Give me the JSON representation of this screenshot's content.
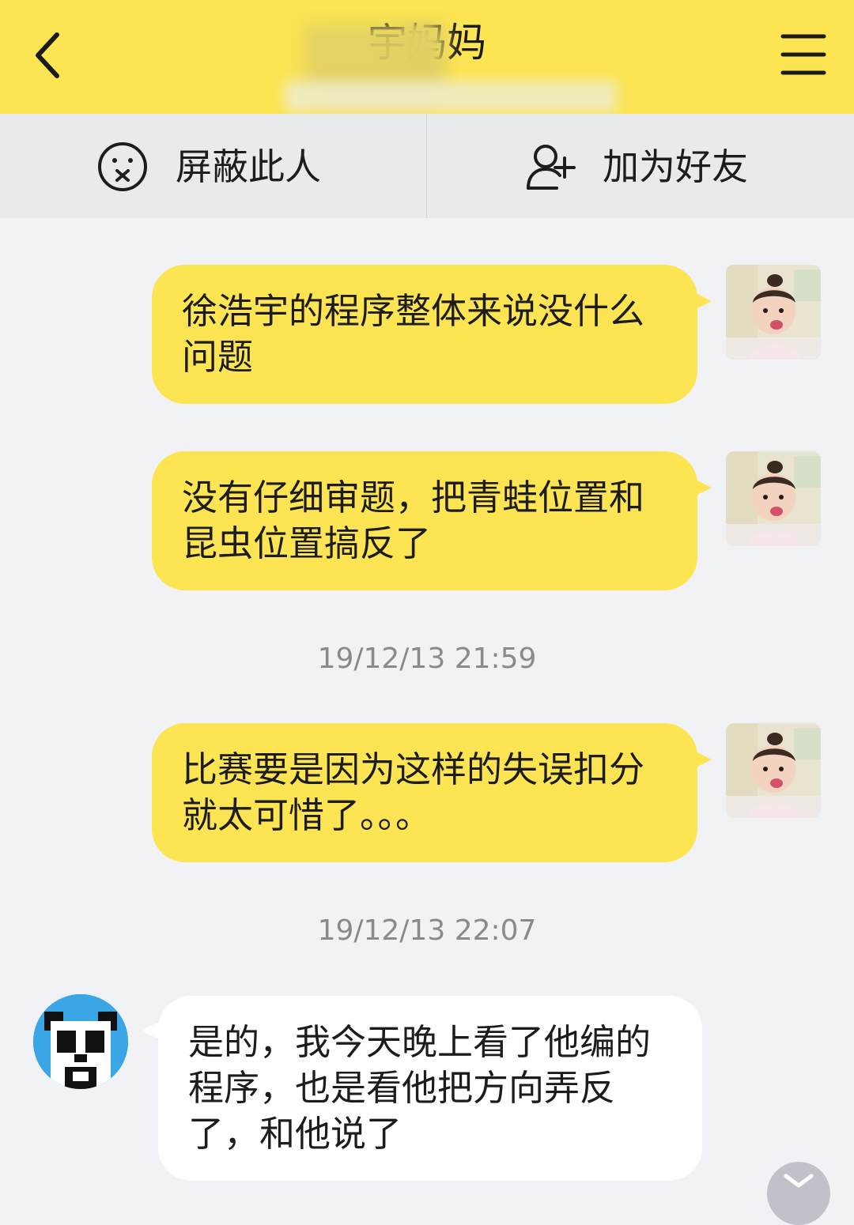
{
  "header": {
    "title": "宇妈妈",
    "back_icon": "chevron-left-icon",
    "menu_icon": "hamburger-menu-icon",
    "background_color": "#fce453"
  },
  "action_bar": {
    "block": {
      "label": "屏蔽此人",
      "icon": "blocked-face-icon"
    },
    "add_friend": {
      "label": "加为好友",
      "icon": "add-person-icon"
    }
  },
  "messages": [
    {
      "side": "right",
      "text": "徐浩宇的程序整体来说没什么问题"
    },
    {
      "side": "right",
      "text": "没有仔细审题，把青蛙位置和昆虫位置搞反了"
    },
    {
      "type": "timestamp",
      "text": "19/12/13 21:59"
    },
    {
      "side": "right",
      "text": "比赛要是因为这样的失误扣分就太可惜了。。。"
    },
    {
      "type": "timestamp",
      "text": "19/12/13 22:07"
    },
    {
      "side": "left",
      "text": "是的，我今天晚上看了他编的程序，也是看他把方向弄反了，和他说了"
    }
  ],
  "colors": {
    "outgoing_bubble": "#fce453",
    "incoming_bubble": "#ffffff",
    "chat_background": "#f1f2f6",
    "timestamp_text": "#8a8a8a"
  }
}
